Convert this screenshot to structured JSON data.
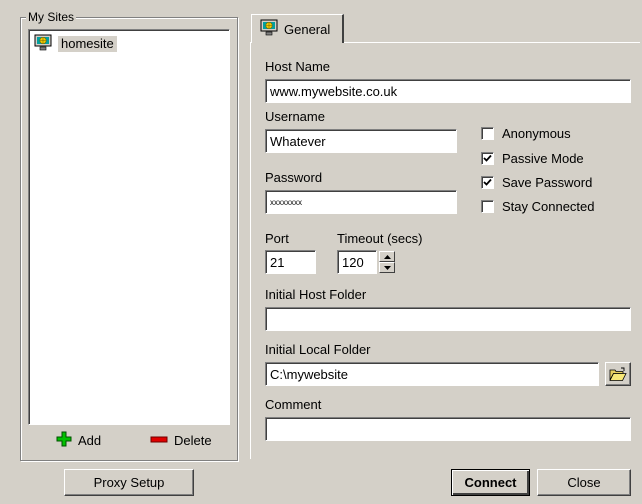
{
  "sites_group": {
    "legend": "My Sites",
    "items": [
      {
        "label": "homesite",
        "icon": "site-globe-icon"
      }
    ],
    "add_label": "Add",
    "delete_label": "Delete"
  },
  "tabs": [
    {
      "label": "General",
      "icon": "site-globe-icon"
    }
  ],
  "form": {
    "host_name": {
      "label": "Host Name",
      "value": "www.mywebsite.co.uk"
    },
    "username": {
      "label": "Username",
      "value": "Whatever"
    },
    "password": {
      "label": "Password",
      "value": "xxxxxxxx"
    },
    "port": {
      "label": "Port",
      "value": "21"
    },
    "timeout": {
      "label": "Timeout (secs)",
      "value": "120"
    },
    "initial_host_folder": {
      "label": "Initial Host Folder",
      "value": ""
    },
    "initial_local_folder": {
      "label": "Initial Local Folder",
      "value": "C:\\mywebsite"
    },
    "comment": {
      "label": "Comment",
      "value": ""
    }
  },
  "options": [
    {
      "label": "Anonymous",
      "checked": false
    },
    {
      "label": "Passive Mode",
      "checked": true
    },
    {
      "label": "Save Password",
      "checked": true
    },
    {
      "label": "Stay Connected",
      "checked": false
    }
  ],
  "buttons": {
    "proxy_setup": "Proxy Setup",
    "connect": "Connect",
    "close": "Close"
  },
  "colors": {
    "face": "#d4d0c8",
    "add_icon": "#00c000",
    "delete_icon": "#e00000"
  }
}
